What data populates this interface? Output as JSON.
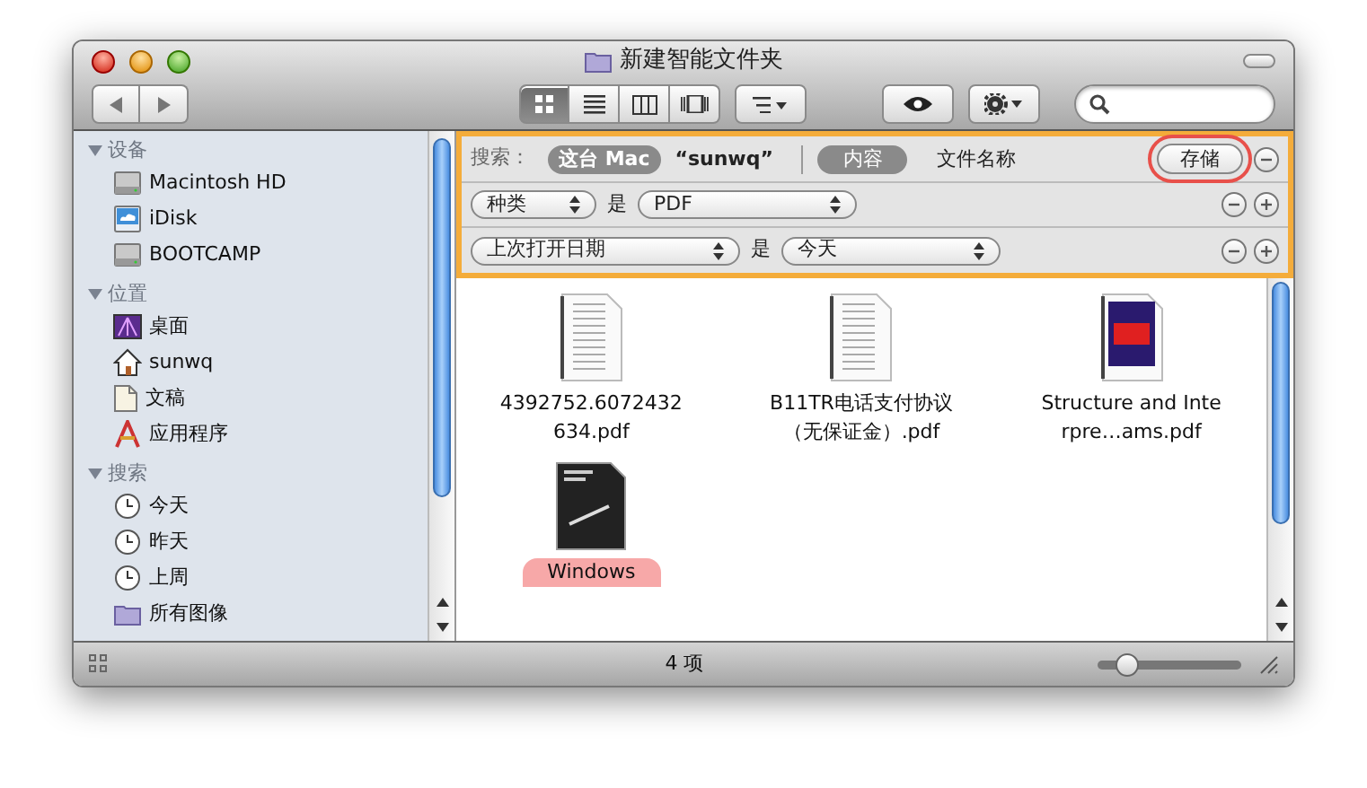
{
  "window": {
    "title": "新建智能文件夹"
  },
  "toolbar": {
    "views": [
      {
        "kind": "icon",
        "selected": true
      },
      {
        "kind": "list",
        "selected": false
      },
      {
        "kind": "columns",
        "selected": false
      },
      {
        "kind": "coverflow",
        "selected": false
      }
    ]
  },
  "sidebar": {
    "sections": [
      {
        "title": "设备",
        "expanded": true,
        "items": [
          {
            "label": "Macintosh HD",
            "kind": "disk"
          },
          {
            "label": "iDisk",
            "kind": "idisk"
          },
          {
            "label": "BOOTCAMP",
            "kind": "disk"
          }
        ]
      },
      {
        "title": "位置",
        "expanded": true,
        "items": [
          {
            "label": "桌面",
            "kind": "desktop"
          },
          {
            "label": "sunwq",
            "kind": "home"
          },
          {
            "label": "文稿",
            "kind": "document"
          },
          {
            "label": "应用程序",
            "kind": "apps"
          }
        ]
      },
      {
        "title": "搜索",
        "expanded": true,
        "items": [
          {
            "label": "今天",
            "kind": "clock"
          },
          {
            "label": "昨天",
            "kind": "clock"
          },
          {
            "label": "上周",
            "kind": "clock"
          },
          {
            "label": "所有图像",
            "kind": "smartfolder"
          }
        ]
      }
    ]
  },
  "search": {
    "label": "搜索：",
    "scopes": [
      {
        "label": "这台 Mac",
        "selected": true
      },
      {
        "label": "“sunwq”",
        "selected": false
      }
    ],
    "fields": [
      {
        "label": "内容",
        "selected": true
      },
      {
        "label": "文件名称",
        "selected": false
      }
    ],
    "save_button": "存储",
    "criteria": [
      {
        "attribute": "种类",
        "operator": "是",
        "value": "PDF"
      },
      {
        "attribute": "上次打开日期",
        "operator": "是",
        "value": "今天"
      }
    ]
  },
  "files": [
    {
      "name": "4392752.6072432634.pdf",
      "kind": "text"
    },
    {
      "name": "B11TR电话支付协议（无保证金）.pdf",
      "kind": "text"
    },
    {
      "name": "Structure and Interpre…ams.pdf",
      "kind": "cover"
    },
    {
      "name": "Windows",
      "kind": "dark",
      "color": "#f7a8a8"
    }
  ],
  "status_bar": {
    "count": "4 项",
    "zoom": {
      "level": 0.2
    }
  }
}
